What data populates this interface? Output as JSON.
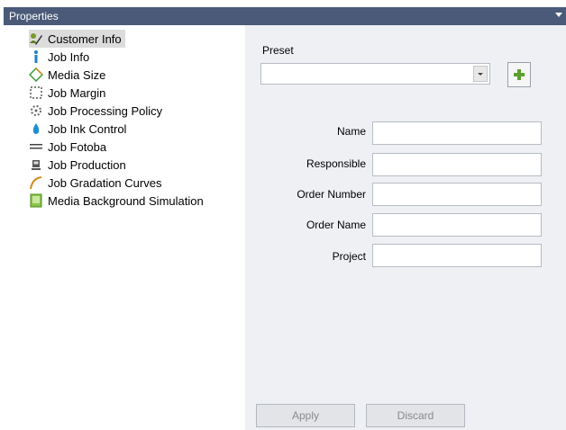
{
  "window": {
    "title": "Properties"
  },
  "tree": {
    "items": [
      {
        "label": "Customer Info",
        "icon": "customer-info-icon",
        "selected": true
      },
      {
        "label": "Job Info",
        "icon": "info-icon"
      },
      {
        "label": "Media Size",
        "icon": "media-size-icon"
      },
      {
        "label": "Job Margin",
        "icon": "margin-icon"
      },
      {
        "label": "Job Processing Policy",
        "icon": "processing-policy-icon"
      },
      {
        "label": "Job Ink Control",
        "icon": "ink-drop-icon"
      },
      {
        "label": "Job Fotoba",
        "icon": "fotoba-icon"
      },
      {
        "label": "Job Production",
        "icon": "production-icon"
      },
      {
        "label": "Job Gradation Curves",
        "icon": "gradation-curve-icon"
      },
      {
        "label": "Media Background Simulation",
        "icon": "background-simulation-icon"
      }
    ]
  },
  "form": {
    "preset_label": "Preset",
    "preset_value": "",
    "fields": [
      {
        "label": "Name",
        "value": ""
      },
      {
        "label": "Responsible",
        "value": ""
      },
      {
        "label": "Order Number",
        "value": ""
      },
      {
        "label": "Order Name",
        "value": ""
      },
      {
        "label": "Project",
        "value": ""
      }
    ]
  },
  "buttons": {
    "apply": "Apply",
    "discard": "Discard"
  },
  "colors": {
    "titlebar": "#4a5a78",
    "panel": "#eef0f4",
    "add_plus": "#5aa02c",
    "selection": "#dcdcdc"
  }
}
